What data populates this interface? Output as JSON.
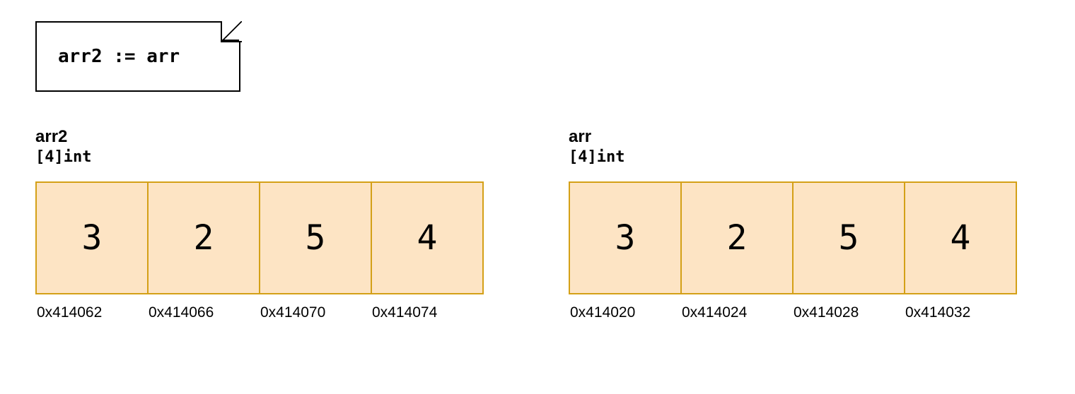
{
  "note": {
    "code": "arr2 := arr"
  },
  "arrays": [
    {
      "name": "arr2",
      "type": "[4]int",
      "cells": [
        "3",
        "2",
        "5",
        "4"
      ],
      "addresses": [
        "0x414062",
        "0x414066",
        "0x414070",
        "0x414074"
      ]
    },
    {
      "name": "arr",
      "type": "[4]int",
      "cells": [
        "3",
        "2",
        "5",
        "4"
      ],
      "addresses": [
        "0x414020",
        "0x414024",
        "0x414028",
        "0x414032"
      ]
    }
  ]
}
